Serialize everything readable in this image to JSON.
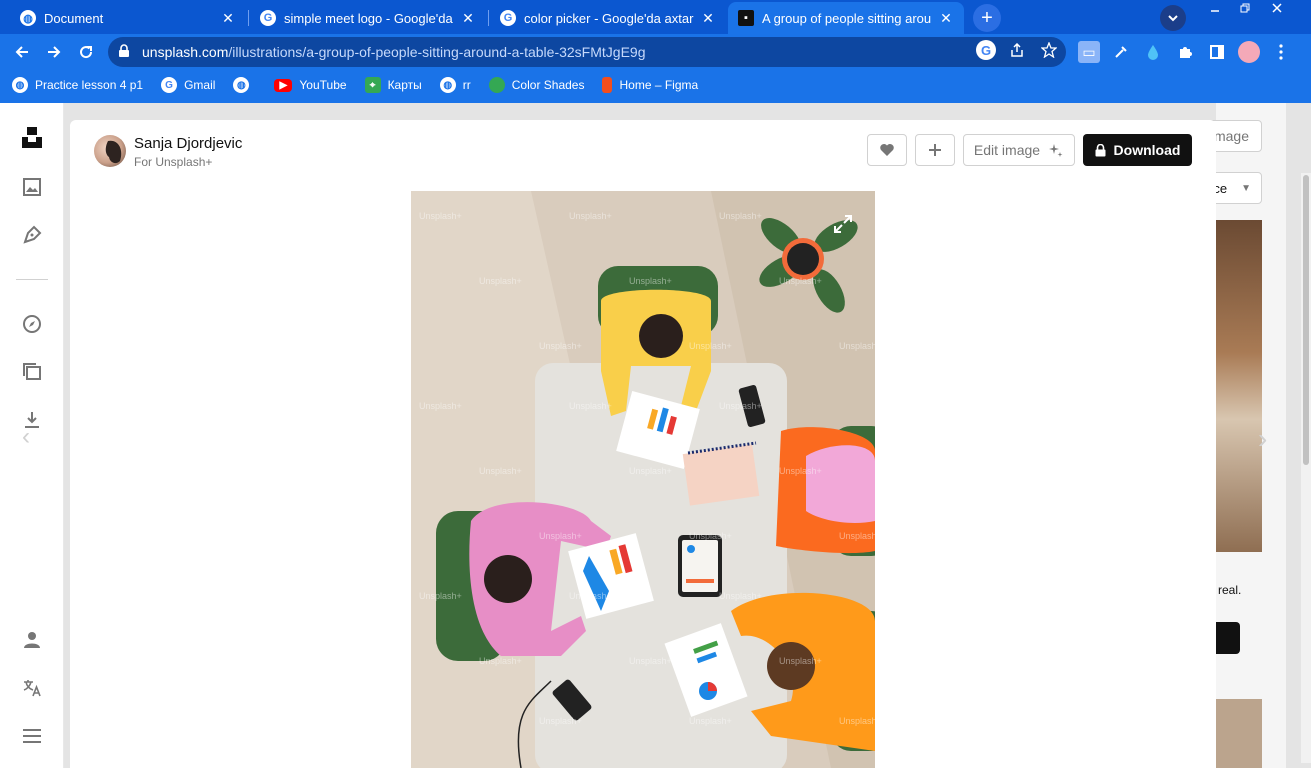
{
  "browser": {
    "tabs": [
      {
        "title": "Document",
        "icon": "globe-icon",
        "active": false
      },
      {
        "title": "simple meet logo - Google'da ax",
        "icon": "google-icon",
        "active": false
      },
      {
        "title": "color picker - Google'da axtarış",
        "icon": "google-icon",
        "active": false
      },
      {
        "title": "A group of people sitting around",
        "icon": "unsplash-icon",
        "active": true
      }
    ],
    "close_glyph": "✕",
    "new_tab_glyph": "+",
    "url_host": "unsplash.com",
    "url_path": "/illustrations/a-group-of-people-sitting-around-a-table-32sFMtJgE9g",
    "bookmarks": [
      {
        "label": "Practice lesson 4 p1",
        "icon": "globe-icon",
        "color": "#ffffff"
      },
      {
        "label": "Gmail",
        "icon": "google-icon",
        "color": "#ffffff"
      },
      {
        "label": "",
        "icon": "globe-icon",
        "color": "#ffffff"
      },
      {
        "label": "YouTube",
        "icon": "youtube-icon",
        "color": "#ff0000"
      },
      {
        "label": "Карты",
        "icon": "maps-icon",
        "color": "#34a853"
      },
      {
        "label": "rr",
        "icon": "globe-icon",
        "color": "#ffffff"
      },
      {
        "label": "Color Shades",
        "icon": "color-shades-icon",
        "color": "#34a853"
      },
      {
        "label": "Home – Figma",
        "icon": "figma-icon",
        "color": "#f24e1e"
      }
    ]
  },
  "modal": {
    "author_name": "Sanja Djordjevic",
    "author_sub": "For Unsplash+",
    "edit_label": "Edit image",
    "download_label": "Download",
    "watermark": "Unsplash+"
  },
  "background_page": {
    "button_fragment": "mage",
    "select_fragment": "ce",
    "text_fragment": "real."
  },
  "colors": {
    "chrome_blue": "#1a73e8",
    "tab_strip": "#0b57d0",
    "download_bg": "#111111"
  }
}
